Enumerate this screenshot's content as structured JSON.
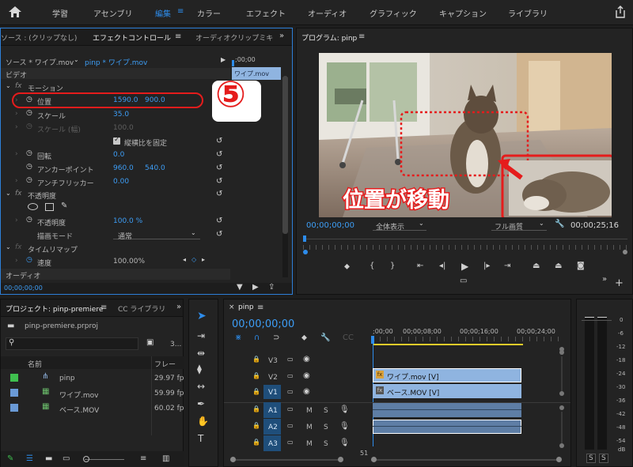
{
  "topnav": {
    "items": [
      "学習",
      "アセンブリ",
      "編集",
      "カラー",
      "エフェクト",
      "オーディオ",
      "グラフィック",
      "キャプション",
      "ライブラリ"
    ],
    "active": "編集"
  },
  "effect_panel": {
    "tabs": [
      "ソース : (クリップなし)",
      "エフェクトコントロール",
      "オーディオクリップミキ"
    ],
    "source_label": "ソース * ワイプ.mov",
    "seq_label": "pinp * ワイプ.mov",
    "ruler_start": ";00;00",
    "clip_name": "ワイプ.mov",
    "video_header": "ビデオ",
    "motion": "モーション",
    "position_label": "位置",
    "position_x": "1590.0",
    "position_y": "900.0",
    "scale_label": "スケール",
    "scale_value": "35.0",
    "scale_w_label": "スケール (幅)",
    "scale_w_value": "100.0",
    "uniform_label": "縦横比を固定",
    "rotation_label": "回転",
    "rotation_value": "0.0",
    "anchor_label": "アンカーポイント",
    "anchor_x": "960.0",
    "anchor_y": "540.0",
    "flicker_label": "アンチフリッカー",
    "flicker_value": "0.00",
    "opacity": "不透明度",
    "opacity_label": "不透明度",
    "opacity_value": "100.0 %",
    "blend_label": "描画モード",
    "blend_value": "通常",
    "timeremap": "タイムリマップ",
    "speed_label": "速度",
    "speed_value": "100.00%",
    "audio_header": "オーディオ",
    "timecode": "00;00;00;00"
  },
  "annotation": {
    "step_number": "⑤",
    "caption": "位置が移動"
  },
  "program": {
    "title": "プログラム: pinp",
    "timecode": "00;00;00;00",
    "zoom": "全体表示",
    "quality": "フル画質",
    "duration": "00;00;25;16"
  },
  "project": {
    "tabs": [
      "プロジェクト: pinp-premiere",
      "CC ライブラリ"
    ],
    "file": "pinp-premiere.prproj",
    "count": "3...",
    "col_name": "名前",
    "col_fps": "フレー",
    "items": [
      {
        "name": "pinp",
        "fps": "29.97 fp",
        "color": "#3fbf4f"
      },
      {
        "name": "ワイプ.mov",
        "fps": "59.99 fp",
        "color": "#6a9ad6"
      },
      {
        "name": "ベース.MOV",
        "fps": "60.02 fp",
        "color": "#6a9ad6"
      }
    ]
  },
  "timeline": {
    "tab": "pinp",
    "timecode": "00;00;00;00",
    "ruler": [
      ";00;00",
      "00;00;08;00",
      "00;00;16;00",
      "00;00;24;00"
    ],
    "tracks": [
      "V3",
      "V2",
      "V1",
      "A1",
      "A2",
      "A3"
    ],
    "clip_v2": "ワイプ.mov [V]",
    "clip_v1": "ベース.MOV [V]",
    "bottom_num": "51"
  },
  "meter": {
    "scale": [
      "0",
      "-6",
      "-12",
      "-18",
      "-24",
      "-30",
      "-36",
      "-42",
      "-48",
      "-54",
      "dB"
    ],
    "solo": [
      "S",
      "S"
    ]
  }
}
